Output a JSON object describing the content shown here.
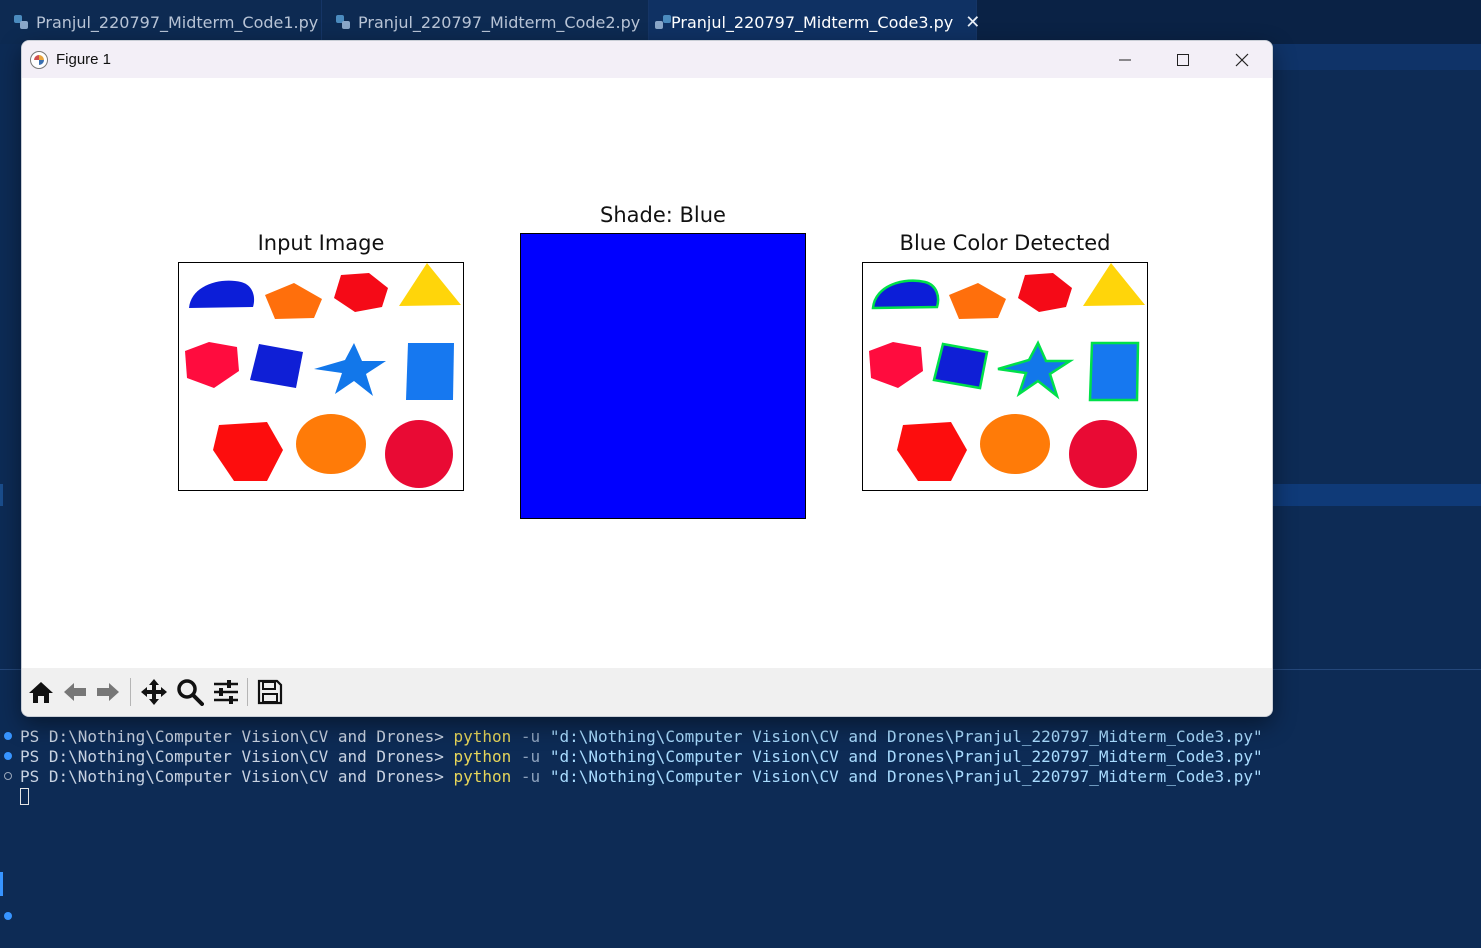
{
  "editor": {
    "tabs": [
      {
        "label": "Pranjul_220797_Midterm_Code1.py"
      },
      {
        "label": "Pranjul_220797_Midterm_Code2.py"
      },
      {
        "label": "Pranjul_220797_Midterm_Code3.py",
        "active": true,
        "close": "✕"
      }
    ]
  },
  "figure_window": {
    "title": "Figure 1",
    "controls": [
      "minimize-icon",
      "maximize-icon",
      "close-icon"
    ]
  },
  "subplots": [
    {
      "title": "Input Image"
    },
    {
      "title": "Shade: Blue",
      "fill_color": "#0000ff"
    },
    {
      "title": "Blue Color Detected"
    }
  ],
  "toolbar": {
    "icons": [
      "home-icon",
      "back-arrow-icon",
      "forward-arrow-icon",
      "pan-icon",
      "zoom-icon",
      "configure-subplots-icon",
      "save-icon"
    ]
  },
  "terminal": {
    "lines": [
      {
        "prompt": "PS D:\\Nothing\\Computer Vision\\CV and Drones> ",
        "cmd": "python",
        "flag": " -u ",
        "arg": "\"d:\\Nothing\\Computer Vision\\CV and Drones\\Pranjul_220797_Midterm_Code3.py\""
      },
      {
        "prompt": "PS D:\\Nothing\\Computer Vision\\CV and Drones> ",
        "cmd": "python",
        "flag": " -u ",
        "arg": "\"d:\\Nothing\\Computer Vision\\CV and Drones\\Pranjul_220797_Midterm_Code3.py\""
      },
      {
        "prompt": "PS D:\\Nothing\\Computer Vision\\CV and Drones> ",
        "cmd": "python",
        "flag": " -u ",
        "arg": "\"d:\\Nothing\\Computer Vision\\CV and Drones\\Pranjul_220797_Midterm_Code3.py\""
      }
    ]
  },
  "colors": {
    "shade_blue": "#0000ff",
    "contour_green": "#00e04a",
    "terminal_bg": "#0d2b55"
  }
}
